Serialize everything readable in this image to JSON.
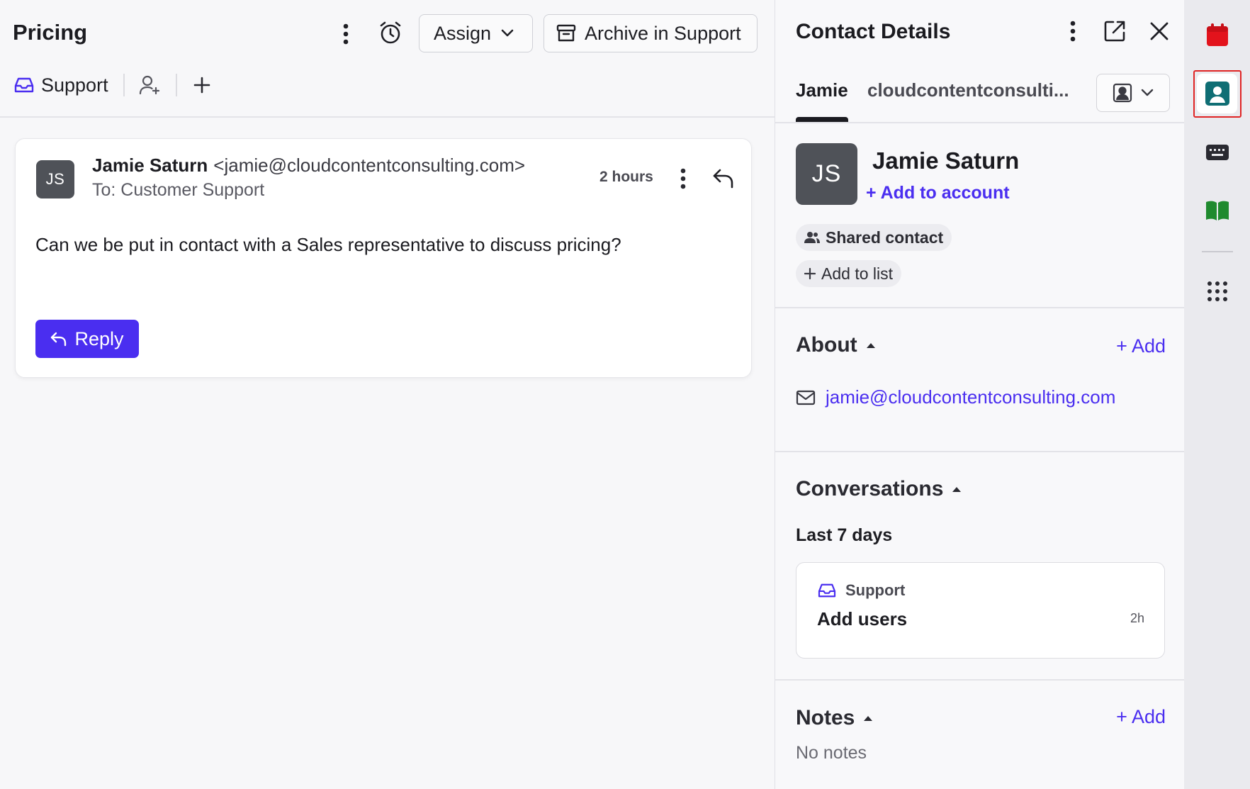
{
  "conversation": {
    "title": "Pricing",
    "assign_label": "Assign",
    "archive_label": "Archive in Support",
    "inbox_label": "Support"
  },
  "message": {
    "avatar_initials": "JS",
    "sender_name": "Jamie Saturn",
    "sender_email": "<jamie@cloudcontentconsulting.com>",
    "to_line": "To: Customer Support",
    "timestamp": "2 hours",
    "body": "Can we be put in contact with a Sales representative to discuss pricing?",
    "reply_label": "Reply"
  },
  "contact_panel": {
    "title": "Contact Details",
    "tabs": [
      "Jamie",
      "cloudcontentconsulti..."
    ],
    "avatar_initials": "JS",
    "name": "Jamie Saturn",
    "add_to_account": "+ Add to account",
    "shared_contact": "Shared contact",
    "add_to_list": "Add to list",
    "about": {
      "title": "About",
      "add_label": "+ Add",
      "email": "jamie@cloudcontentconsulting.com"
    },
    "conversations": {
      "title": "Conversations",
      "period": "Last 7 days",
      "items": [
        {
          "inbox": "Support",
          "subject": "Add users",
          "time": "2h"
        }
      ]
    },
    "notes": {
      "title": "Notes",
      "add_label": "+ Add",
      "empty_text": "No notes"
    }
  },
  "rail": {
    "items": [
      "calendar-icon",
      "contact-card-icon",
      "keyboard-icon",
      "book-icon",
      "apps-grid-icon"
    ],
    "selected": "contact-card-icon"
  },
  "colors": {
    "accent": "#4a2ef0",
    "avatar_bg": "#4f5258",
    "selection_outline": "#e02424",
    "calendar": "#e3131c",
    "contact_card": "#0f6e74",
    "book": "#1f8a2e"
  }
}
